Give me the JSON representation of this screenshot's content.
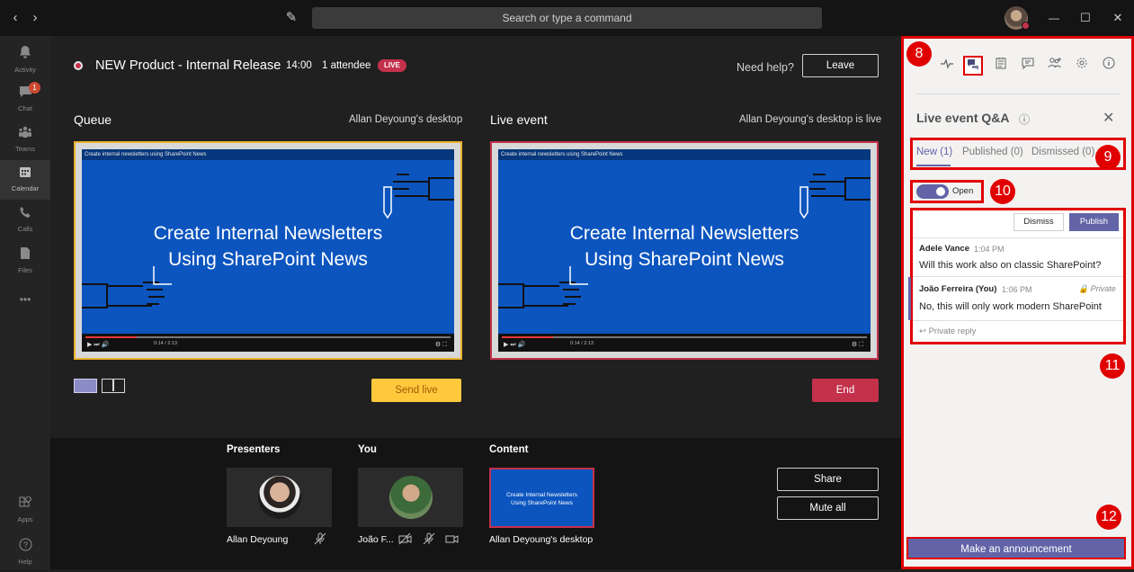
{
  "titlebar": {
    "search_placeholder": "Search or type a command",
    "back_icon": "‹",
    "forward_icon": "›",
    "compose_icon": "✎",
    "minimize_icon": "—",
    "maximize_icon": "☐",
    "close_icon": "✕"
  },
  "rail": [
    {
      "label": "Activity",
      "icon": "bell-icon",
      "glyph": "🔔"
    },
    {
      "label": "Chat",
      "icon": "chat-icon",
      "glyph": "💬",
      "badge": "1"
    },
    {
      "label": "Teams",
      "icon": "teams-icon",
      "glyph": "⁘"
    },
    {
      "label": "Calendar",
      "icon": "calendar-icon",
      "glyph": "▦"
    },
    {
      "label": "Calls",
      "icon": "phone-icon",
      "glyph": "✆"
    },
    {
      "label": "Files",
      "icon": "files-icon",
      "glyph": "▤"
    },
    {
      "label": "",
      "icon": "more-icon",
      "glyph": "•••"
    },
    {
      "label": "Apps",
      "icon": "apps-icon",
      "glyph": "⊞"
    },
    {
      "label": "Help",
      "icon": "help-icon",
      "glyph": "?"
    }
  ],
  "event": {
    "title": "NEW Product - Internal Release",
    "time": "14:00",
    "attendees": "1 attendee",
    "live_badge": "LIVE",
    "help": "Need help?",
    "leave": "Leave"
  },
  "queue": {
    "title": "Queue",
    "source": "Allan Deyoung's desktop",
    "send_live": "Send live"
  },
  "live": {
    "title": "Live event",
    "source": "Allan Deyoung's desktop is live",
    "end": "End"
  },
  "video": {
    "top_text": "Create internal newsletters using SharePoint News",
    "line1": "Create Internal Newsletters",
    "line2": "Using SharePoint News",
    "time": "0:14 / 2:13",
    "controls": "▶ ⏭ 🔊",
    "controls_right": "⚙ ⛶"
  },
  "bottom": {
    "presenters_h": "Presenters",
    "you_h": "You",
    "content_h": "Content",
    "presenter_name": "Allan Deyoung",
    "you_name": "João F...",
    "content_name": "Allan Deyoung's desktop",
    "share": "Share",
    "mute_all": "Mute all"
  },
  "panel": {
    "title": "Live event Q&A",
    "info_icon": "ⓘ",
    "close_icon": "✕",
    "tabs": [
      "New (1)",
      "Published (0)",
      "Dismissed (0)"
    ],
    "toggle_label": "Open",
    "dismiss": "Dismiss",
    "publish": "Publish",
    "q_name": "Adele Vance",
    "q_time": "1:04 PM",
    "q_text": "Will this work also on classic SharePoint?",
    "a_name": "João Ferreira (You)",
    "a_time": "1:06 PM",
    "a_private": "🔒 Private",
    "a_text": "No, this will only work modern SharePoint",
    "reply": "↩  Private reply",
    "announce": "Make an announcement"
  },
  "callouts": [
    "8",
    "9",
    "10",
    "11",
    "12"
  ],
  "colors": {
    "accent": "#6264a7",
    "live_red": "#c4314b",
    "queue_yellow": "#ffc83d",
    "callout_red": "#e00000",
    "video_blue": "#0c55bf"
  }
}
